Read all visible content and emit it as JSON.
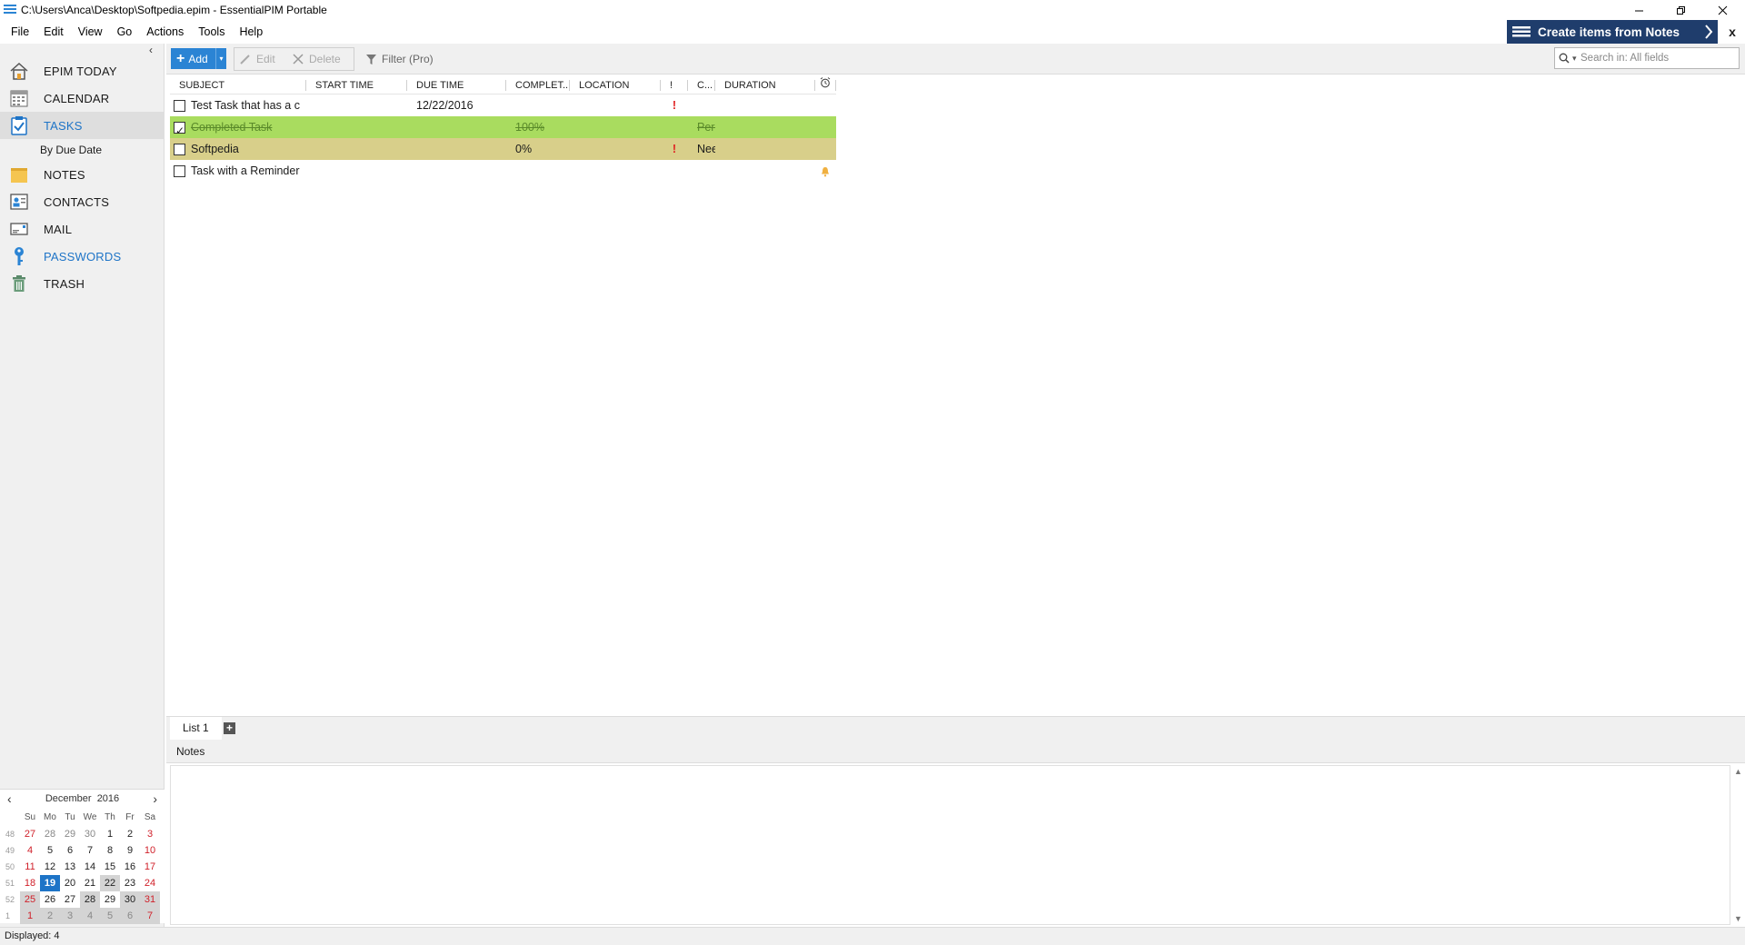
{
  "window": {
    "title": "C:\\Users\\Anca\\Desktop\\Softpedia.epim - EssentialPIM Portable"
  },
  "menu": [
    "File",
    "Edit",
    "View",
    "Go",
    "Actions",
    "Tools",
    "Help"
  ],
  "promo": {
    "label": "Create items from Notes",
    "close": "x"
  },
  "nav": {
    "items": [
      {
        "label": "EPIM TODAY",
        "icon": "home-icon"
      },
      {
        "label": "CALENDAR",
        "icon": "calendar-icon"
      },
      {
        "label": "TASKS",
        "icon": "tasks-icon",
        "active": true
      },
      {
        "label": "NOTES",
        "icon": "notes-icon"
      },
      {
        "label": "CONTACTS",
        "icon": "contacts-icon"
      },
      {
        "label": "MAIL",
        "icon": "mail-icon"
      },
      {
        "label": "PASSWORDS",
        "icon": "key-icon"
      },
      {
        "label": "TRASH",
        "icon": "trash-icon"
      }
    ],
    "tasks_sub": "By Due Date"
  },
  "toolbar": {
    "add": "Add",
    "edit": "Edit",
    "delete": "Delete",
    "filter": "Filter (Pro)",
    "search_placeholder": "Search in: All fields"
  },
  "grid": {
    "columns": [
      "SUBJECT",
      "START TIME",
      "DUE TIME",
      "COMPLET...",
      "LOCATION",
      "!",
      "C...",
      "DURATION"
    ],
    "rows": [
      {
        "checked": false,
        "subject": "Test Task that has a c",
        "start": "",
        "due": "12/22/2016",
        "complete": "",
        "location": "",
        "priority": "!",
        "category": "",
        "duration": "",
        "reminder": false,
        "style": ""
      },
      {
        "checked": true,
        "subject": "Completed Task",
        "start": "",
        "due": "",
        "complete": "100%",
        "location": "",
        "priority": "",
        "category": "Pers",
        "duration": "",
        "reminder": false,
        "style": "green"
      },
      {
        "checked": false,
        "subject": "Softpedia",
        "start": "",
        "due": "",
        "complete": "0%",
        "location": "",
        "priority": "!",
        "category": "Nee",
        "duration": "",
        "reminder": false,
        "style": "tan"
      },
      {
        "checked": false,
        "subject": "Task with a Reminder",
        "start": "",
        "due": "",
        "complete": "",
        "location": "",
        "priority": "",
        "category": "",
        "duration": "",
        "reminder": true,
        "style": ""
      }
    ]
  },
  "tabs": {
    "list1": "List 1",
    "add": "+"
  },
  "notes": {
    "title": "Notes"
  },
  "minical": {
    "month": "December",
    "year": "2016",
    "dow": [
      "Su",
      "Mo",
      "Tu",
      "We",
      "Th",
      "Fr",
      "Sa"
    ],
    "weeks": [
      {
        "wk": "48",
        "days": [
          "27",
          "28",
          "29",
          "30",
          "1",
          "2",
          "3"
        ]
      },
      {
        "wk": "49",
        "days": [
          "4",
          "5",
          "6",
          "7",
          "8",
          "9",
          "10"
        ]
      },
      {
        "wk": "50",
        "days": [
          "11",
          "12",
          "13",
          "14",
          "15",
          "16",
          "17"
        ]
      },
      {
        "wk": "51",
        "days": [
          "18",
          "19",
          "20",
          "21",
          "22",
          "23",
          "24"
        ]
      },
      {
        "wk": "52",
        "days": [
          "25",
          "26",
          "27",
          "28",
          "29",
          "30",
          "31"
        ]
      },
      {
        "wk": "1",
        "days": [
          "1",
          "2",
          "3",
          "4",
          "5",
          "6",
          "7"
        ]
      }
    ],
    "today": "19"
  },
  "status": {
    "text": "Displayed: 4"
  },
  "colors": {
    "accent": "#1e74c7",
    "promo_bg": "#1f3d6c",
    "row_green": "#a9dc5f",
    "row_tan": "#d8cf8a",
    "priority": "#e02020"
  }
}
